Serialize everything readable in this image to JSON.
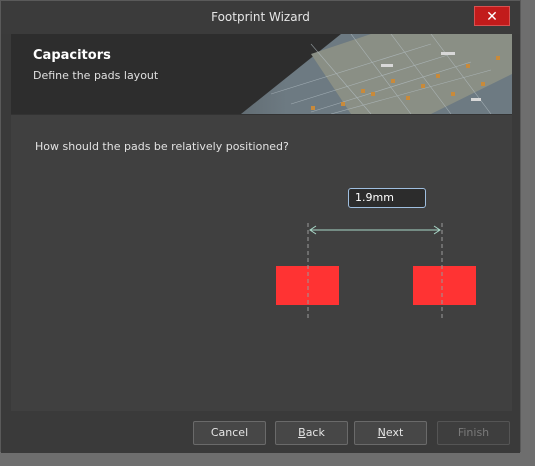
{
  "window": {
    "title": "Footprint Wizard",
    "close_glyph": "✕"
  },
  "banner": {
    "heading": "Capacitors",
    "subheading": "Define the pads layout"
  },
  "content": {
    "question": "How should the pads be relatively positioned?",
    "pad_spacing_value": "1.9mm",
    "pad_color": "#ff3333"
  },
  "buttons": {
    "cancel": "Cancel",
    "back_accel": "B",
    "back_rest": "ack",
    "next_accel": "N",
    "next_rest": "ext",
    "finish": "Finish"
  },
  "icons": {
    "close": "close-icon"
  },
  "colors": {
    "accent_close": "#c21b1b",
    "pad": "#ff3333"
  }
}
